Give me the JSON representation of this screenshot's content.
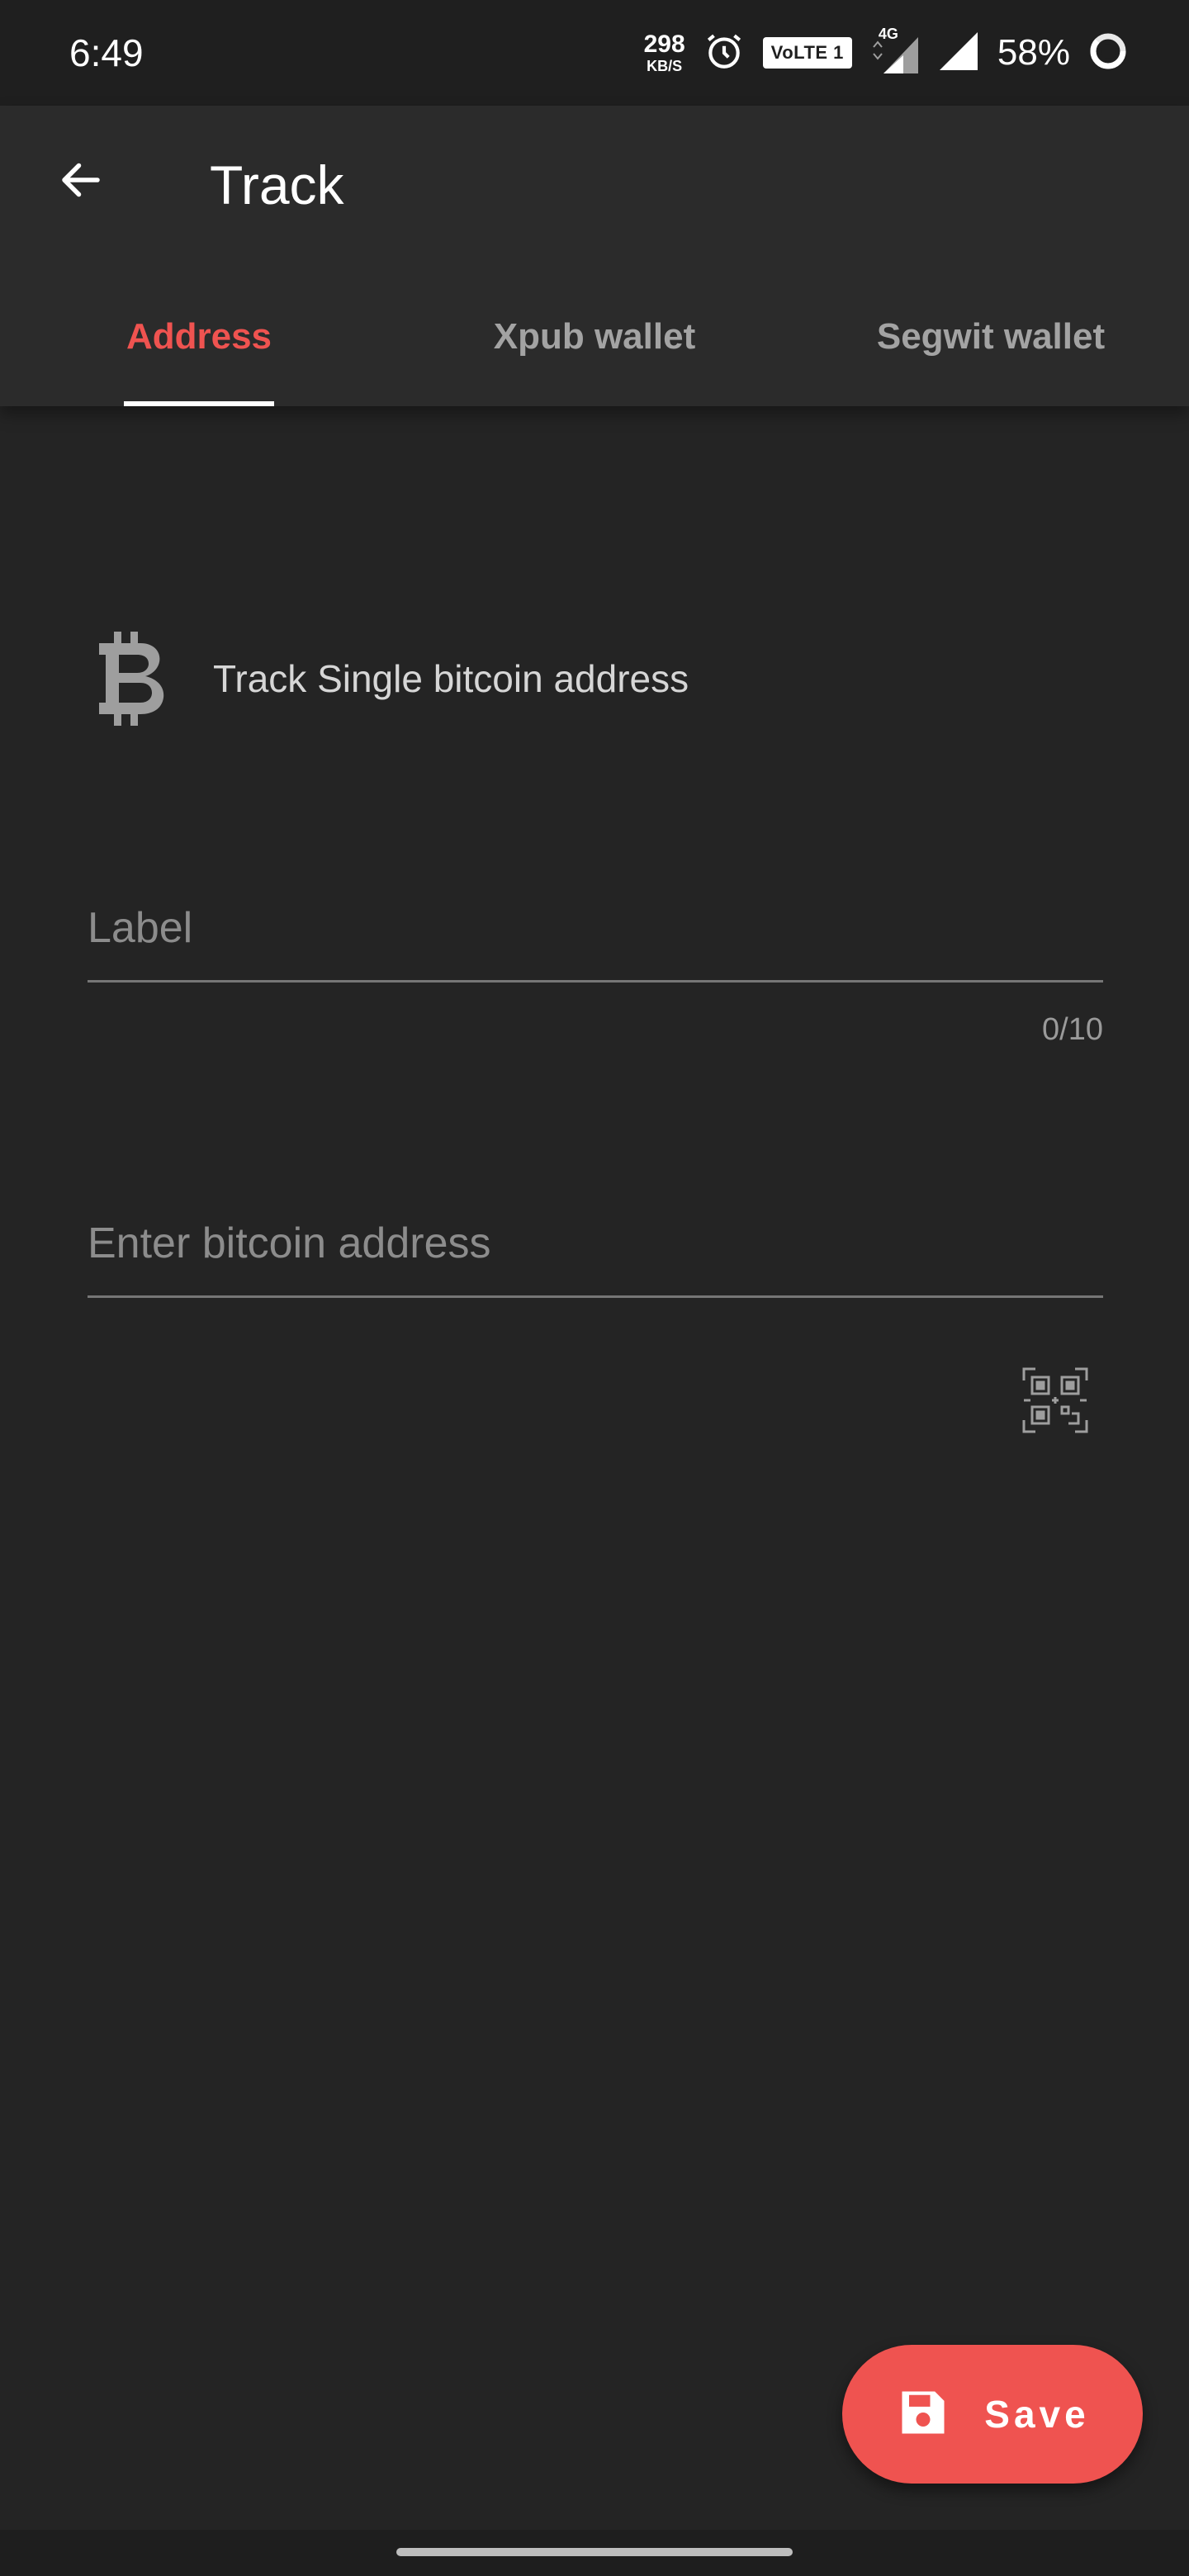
{
  "status_bar": {
    "time": "6:49",
    "net_speed_value": "298",
    "net_speed_unit": "KB/S",
    "volte_label": "VoLTE 1",
    "network_type": "4G",
    "battery_percent": "58%"
  },
  "app_bar": {
    "title": "Track",
    "back_icon": "arrow-back-icon"
  },
  "tabs": [
    {
      "label": "Address",
      "active": true
    },
    {
      "label": "Xpub wallet",
      "active": false
    },
    {
      "label": "Segwit wallet",
      "active": false
    }
  ],
  "content": {
    "intro_text": "Track Single bitcoin address",
    "intro_icon": "bitcoin-icon",
    "label_field": {
      "placeholder": "Label",
      "value": "",
      "counter": "0/10"
    },
    "address_field": {
      "placeholder": "Enter bitcoin address",
      "value": ""
    },
    "scan_icon": "qr-code-scan-icon"
  },
  "fab": {
    "label": "Save",
    "icon": "save-icon"
  },
  "colors": {
    "accent": "#ef5350",
    "background": "#242424",
    "app_bar": "#2b2b2b",
    "status_bar": "#1f1f1f"
  }
}
